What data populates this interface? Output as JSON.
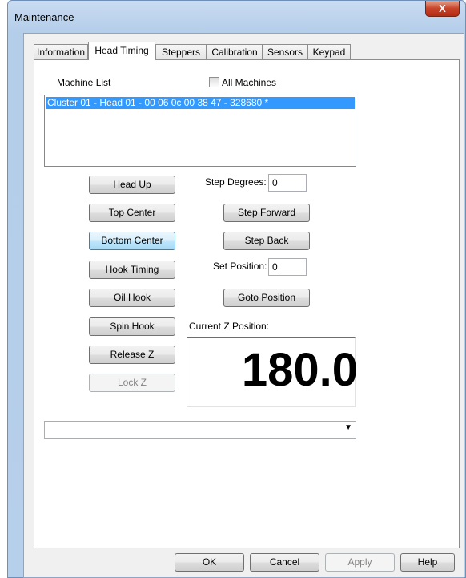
{
  "window": {
    "title": "Maintenance",
    "close_label": "X"
  },
  "tabs": [
    {
      "label": "Information"
    },
    {
      "label": "Head Timing"
    },
    {
      "label": "Steppers"
    },
    {
      "label": "Calibration"
    },
    {
      "label": "Sensors"
    },
    {
      "label": "Keypad"
    }
  ],
  "active_tab": "Head Timing",
  "head_timing": {
    "machine_list_label": "Machine List",
    "all_machines_label": "All Machines",
    "all_machines_checked": false,
    "machine_list_items": [
      "Cluster 01 - Head 01 - 00 06 0c 00 38 47 - 328680 *"
    ],
    "buttons": {
      "head_up": "Head Up",
      "top_center": "Top Center",
      "bottom_center": "Bottom Center",
      "hook_timing": "Hook Timing",
      "oil_hook": "Oil Hook",
      "spin_hook": "Spin Hook",
      "release_z": "Release Z",
      "lock_z": "Lock Z",
      "step_forward": "Step Forward",
      "step_back": "Step Back",
      "goto_position": "Goto Position"
    },
    "step_degrees_label": "Step Degrees:",
    "step_degrees_value": "0",
    "set_position_label": "Set Position:",
    "set_position_value": "0",
    "current_z_label": "Current Z Position:",
    "current_z_value": "180.0",
    "combo_value": ""
  },
  "footer": {
    "ok": "OK",
    "cancel": "Cancel",
    "apply": "Apply",
    "help": "Help"
  }
}
